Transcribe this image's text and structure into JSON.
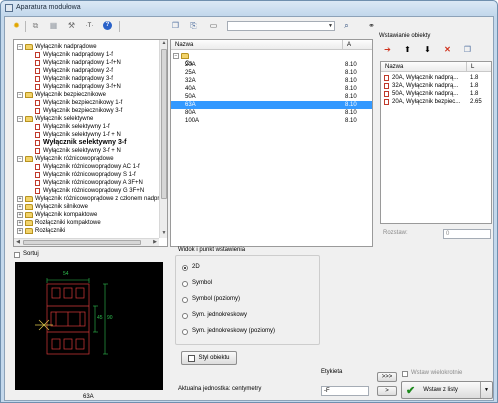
{
  "window": {
    "title": "Aparatura modułowa"
  },
  "toolbar": {
    "dropdown_value": ""
  },
  "tree": [
    {
      "label": "Wyłącznik nadprądowe",
      "level": 0,
      "type": "folder",
      "expanded": true
    },
    {
      "label": "Wyłącznik nadprądowy 1-f",
      "level": 1,
      "type": "page"
    },
    {
      "label": "Wyłącznik nadprądowy 1-f+N",
      "level": 1,
      "type": "page"
    },
    {
      "label": "Wyłącznik nadprądowy 2-f",
      "level": 1,
      "type": "page"
    },
    {
      "label": "Wyłącznik nadprądowy 3-f",
      "level": 1,
      "type": "page"
    },
    {
      "label": "Wyłącznik nadprądowy 3-f+N",
      "level": 1,
      "type": "page"
    },
    {
      "label": "Wyłącznik bezpiecznikowe",
      "level": 0,
      "type": "folder",
      "expanded": true
    },
    {
      "label": "Wyłącznik bezpiecznikowy 1-f",
      "level": 1,
      "type": "page"
    },
    {
      "label": "Wyłącznik bezpiecznikowy 3-f",
      "level": 1,
      "type": "page"
    },
    {
      "label": "Wyłącznik selektywne",
      "level": 0,
      "type": "folder",
      "expanded": true
    },
    {
      "label": "Wyłącznik selektywny 1-f",
      "level": 1,
      "type": "page"
    },
    {
      "label": "Wyłącznik selektywny 1-f + N",
      "level": 1,
      "type": "page"
    },
    {
      "label": "Wyłącznik selektywny 3-f",
      "level": 1,
      "type": "page",
      "bold": true
    },
    {
      "label": "Wyłącznik selektywny 3-f + N",
      "level": 1,
      "type": "page"
    },
    {
      "label": "Wyłącznik różnicowoprądowe",
      "level": 0,
      "type": "folder",
      "expanded": true
    },
    {
      "label": "Wyłącznik różnicowoprądowy AC 1-f",
      "level": 1,
      "type": "page"
    },
    {
      "label": "Wyłącznik różnicowoprądowy S 1-f",
      "level": 1,
      "type": "page"
    },
    {
      "label": "Wyłącznik różnicowoprądowy A 3F+N",
      "level": 1,
      "type": "page"
    },
    {
      "label": "Wyłącznik różnicowoprądowy G 3F+N",
      "level": 1,
      "type": "page"
    },
    {
      "label": "Wyłącznik różnicowoprądowe z członem nadprąd",
      "level": 0,
      "type": "folder",
      "expanded": false
    },
    {
      "label": "Wyłącznik silnikowe",
      "level": 0,
      "type": "folder",
      "expanded": false
    },
    {
      "label": "Wyłącznik kompaktowe",
      "level": 0,
      "type": "folder",
      "expanded": false
    },
    {
      "label": "Rozłączniki kompaktowe",
      "level": 0,
      "type": "folder",
      "expanded": false
    },
    {
      "label": "Rozłączniki",
      "level": 0,
      "type": "folder",
      "expanded": false
    }
  ],
  "list": {
    "headers": {
      "name": "Nazwa",
      "a": "A"
    },
    "group": "Cs",
    "rows": [
      {
        "name": "20A",
        "a": "8.10"
      },
      {
        "name": "25A",
        "a": "8.10"
      },
      {
        "name": "32A",
        "a": "8.10"
      },
      {
        "name": "40A",
        "a": "8.10"
      },
      {
        "name": "50A",
        "a": "8.10"
      },
      {
        "name": "63A",
        "a": "8.10",
        "selected": true
      },
      {
        "name": "80A",
        "a": "8.10"
      },
      {
        "name": "100A",
        "a": "8.10"
      }
    ]
  },
  "insert": {
    "title": "Wstawianie obiekty",
    "headers": {
      "name": "Nazwa",
      "l": "L"
    },
    "rows": [
      {
        "name": "20A, Wyłącznik nadprą...",
        "l": "1.8"
      },
      {
        "name": "32A, Wyłącznik nadprą...",
        "l": "1.8"
      },
      {
        "name": "50A, Wyłącznik nadprą...",
        "l": "1.8"
      },
      {
        "name": "20A, Wyłącznik bezpiec...",
        "l": "2.65"
      }
    ],
    "rozstaw_label": "Rozstaw:",
    "rozstaw_value": "0"
  },
  "preview": {
    "sort_label": "Sortuj",
    "caption": "63A",
    "dims": {
      "width": "54",
      "height": "90",
      "side": "45"
    }
  },
  "view": {
    "title": "Widok i punkt wstawienia",
    "options": [
      {
        "label": "2D",
        "checked": true
      },
      {
        "label": "Symbol",
        "checked": false
      },
      {
        "label": "Symbol (poziomy)",
        "checked": false
      },
      {
        "label": "Sym. jednokreskowy",
        "checked": false
      },
      {
        "label": "Sym. jednokreskowy (poziomy)",
        "checked": false
      }
    ],
    "style_button": "Styl obiektu"
  },
  "bottom": {
    "etykieta_label": "Etykieta",
    "etykieta_value": "-F",
    "unit_text": "Aktualna jednostka: centymetry",
    "multi_label": "Wstaw wielokrotnie",
    "insert_button": "Wstaw z listy",
    "nav_more": ">>>",
    "nav_next": ">"
  }
}
